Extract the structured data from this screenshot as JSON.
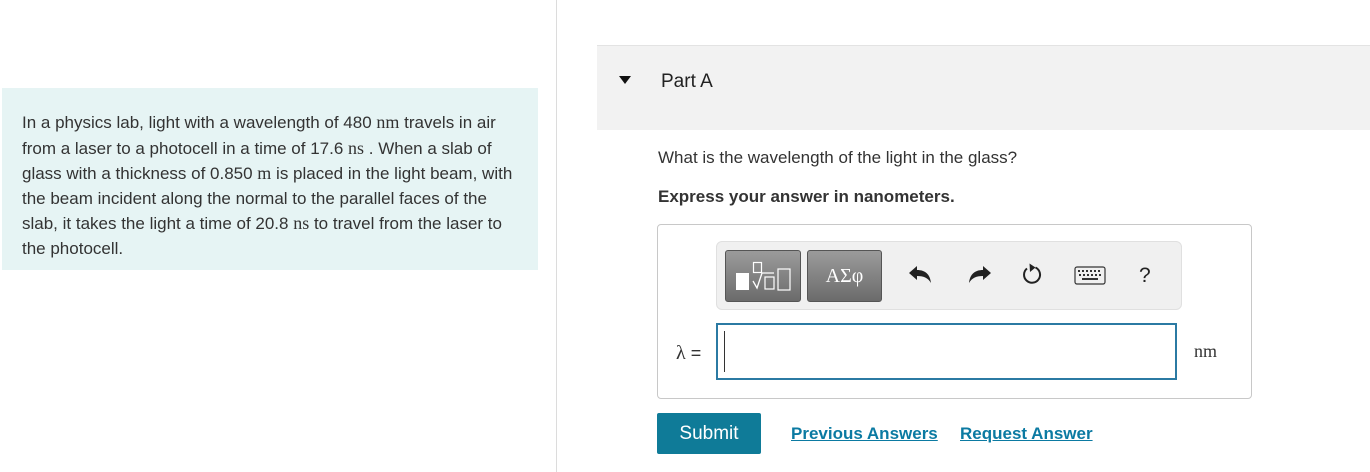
{
  "problem": {
    "segments": [
      {
        "text": "In a physics lab, light with a wavelength of 480 ",
        "unit": false
      },
      {
        "text": "nm",
        "unit": true
      },
      {
        "text": " travels in air from a laser to a photocell in a time of 17.6 ",
        "unit": false
      },
      {
        "text": "ns",
        "unit": true
      },
      {
        "text": " . When a slab of glass with a thickness of 0.850 ",
        "unit": false
      },
      {
        "text": "m",
        "unit": true
      },
      {
        "text": " is placed in the light beam, with the beam incident along the normal to the parallel faces of the slab, it takes the light a time of 20.8 ",
        "unit": false
      },
      {
        "text": "ns",
        "unit": true
      },
      {
        "text": " to travel from the laser to the photocell.",
        "unit": false
      }
    ]
  },
  "part": {
    "title": "Part A",
    "expanded": true
  },
  "question": "What is the wavelength of the light in the glass?",
  "instruction": "Express your answer in nanometers.",
  "toolbar": {
    "greek_label": "ΑΣφ",
    "help_label": "?",
    "icons": [
      "templates-icon",
      "greek-icon",
      "undo-icon",
      "redo-icon",
      "reset-icon",
      "keyboard-icon",
      "help-icon"
    ]
  },
  "answer": {
    "symbol": "λ",
    "equals": "=",
    "value": "",
    "unit": "nm"
  },
  "actions": {
    "submit_label": "Submit",
    "previous_answers_label": "Previous Answers",
    "request_answer_label": "Request Answer"
  },
  "colors": {
    "problem_background": "#e6f4f4",
    "header_background": "#f2f2f2",
    "accent": "#0f7b98",
    "link": "#0b7aa2",
    "input_border": "#2b7aa3"
  }
}
